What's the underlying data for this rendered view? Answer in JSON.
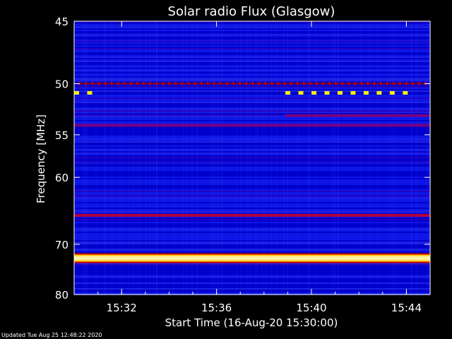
{
  "chart_data": {
    "type": "heatmap",
    "title": "Solar radio Flux (Glasgow)",
    "xlabel": "Start Time (16-Aug-20 15:30:00)",
    "ylabel": "Frequency [MHz]",
    "x_ticks": [
      "15:32",
      "15:36",
      "15:40",
      "15:44"
    ],
    "x_tick_minutes": [
      2,
      6,
      10,
      14
    ],
    "xlim_minutes": [
      0,
      15
    ],
    "y_ticks": [
      45,
      50,
      55,
      60,
      70,
      80
    ],
    "ylim_mhz": [
      45,
      80
    ],
    "y_scale": "reciprocal",
    "grid": false,
    "colormap": [
      "#0000cc",
      "#2020ff",
      "#9000a0",
      "#cc0000",
      "#ffcc00",
      "#ffffff"
    ],
    "background_band_color": "#1a2cff",
    "emission_lines": [
      {
        "freq_mhz": 50.0,
        "color": "#cc0000",
        "pattern": "dotted",
        "start_min": 0.2,
        "end_min": 14.8
      },
      {
        "freq_mhz": 54.0,
        "color": "#7a0080",
        "pattern": "solid",
        "start_min": 0,
        "end_min": 15
      },
      {
        "freq_mhz": 65.3,
        "color": "#b0003a",
        "pattern": "solid",
        "start_min": 0,
        "end_min": 15
      },
      {
        "freq_mhz": 72.5,
        "color": "#fff2a0",
        "pattern": "solid",
        "start_min": 0,
        "end_min": 15
      },
      {
        "freq_mhz": 53.0,
        "color": "#7a0080",
        "pattern": "solid",
        "start_min": 8.9,
        "end_min": 15
      }
    ],
    "bursts": [
      {
        "freq_mhz": 50.8,
        "start_min": 0.0,
        "end_min": 0.9,
        "color": "#ffee00"
      },
      {
        "freq_mhz": 50.8,
        "start_min": 8.9,
        "end_min": 13.9,
        "color": "#ffee00"
      }
    ]
  },
  "footer": {
    "updated": "Updated Tue Aug 25 12:48:22 2020"
  }
}
